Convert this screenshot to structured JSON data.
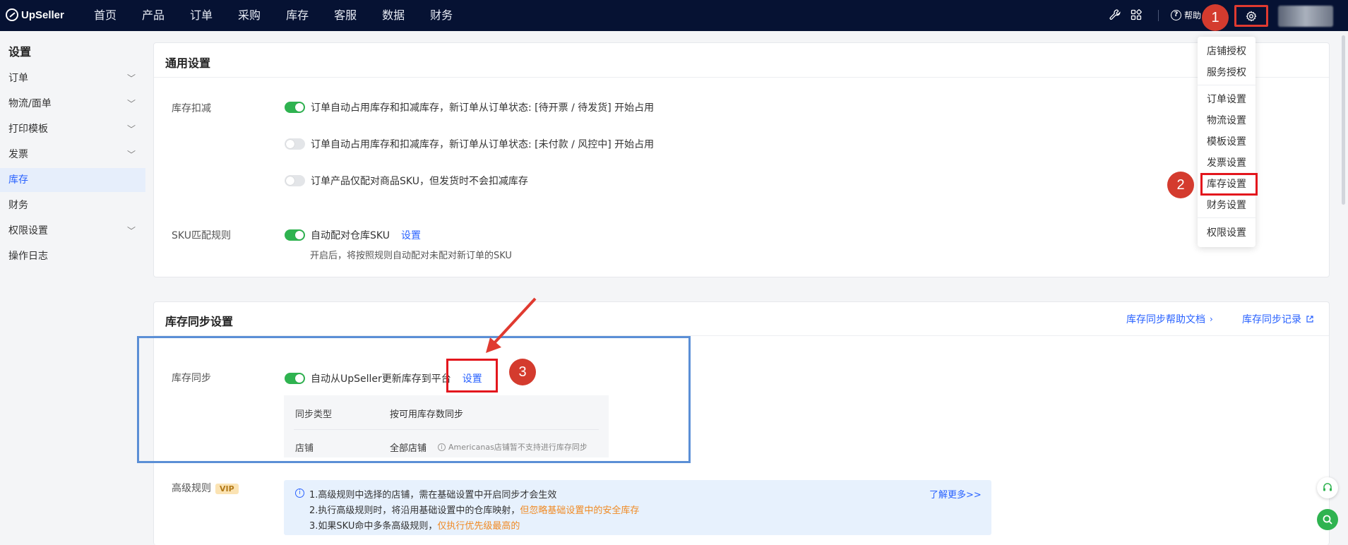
{
  "brand": "UpSeller",
  "nav": [
    "首页",
    "产品",
    "订单",
    "采购",
    "库存",
    "客服",
    "数据",
    "财务"
  ],
  "topbar": {
    "help_label": "帮助"
  },
  "sidebar": {
    "title": "设置",
    "items": [
      {
        "label": "订单",
        "expandable": true
      },
      {
        "label": "物流/面单",
        "expandable": true
      },
      {
        "label": "打印模板",
        "expandable": true
      },
      {
        "label": "发票",
        "expandable": true
      },
      {
        "label": "库存",
        "expandable": false,
        "active": true
      },
      {
        "label": "财务",
        "expandable": false
      },
      {
        "label": "权限设置",
        "expandable": true
      },
      {
        "label": "操作日志",
        "expandable": false
      }
    ]
  },
  "general": {
    "title": "通用设置",
    "stock_deduct_label": "库存扣减",
    "options": [
      {
        "text": "订单自动占用库存和扣减库存，新订单从订单状态: [待开票 / 待发货] 开始占用",
        "on": true
      },
      {
        "text": "订单自动占用库存和扣减库存，新订单从订单状态: [未付款 / 风控中] 开始占用",
        "on": false
      },
      {
        "text": "订单产品仅配对商品SKU，但发货时不会扣减库存",
        "on": false
      }
    ],
    "sku_rule_label": "SKU匹配规则",
    "sku_rule_text": "自动配对仓库SKU",
    "sku_rule_link": "设置",
    "sku_rule_note": "开启后，将按照规则自动配对未配对新订单的SKU"
  },
  "sync": {
    "title": "库存同步设置",
    "help_doc": "库存同步帮助文档",
    "record": "库存同步记录",
    "label": "库存同步",
    "toggle_text": "自动从UpSeller更新库存到平台",
    "settings_link": "设置",
    "type_label": "同步类型",
    "type_value": "按可用库存数同步",
    "store_label": "店铺",
    "store_value": "全部店铺",
    "store_note": "Americanas店铺暂不支持进行库存同步"
  },
  "advanced": {
    "label": "高级规则",
    "vip": "VIP",
    "line1": "1.高级规则中选择的店铺，需在基础设置中开启同步才会生效",
    "line2_a": "2.执行高级规则时，将沿用基础设置中的仓库映射，",
    "line2_b": "但忽略基础设置中的安全库存",
    "line3_a": "3.如果SKU命中多条高级规则，",
    "line3_b": "仅执行优先级最高的",
    "learn_more": "了解更多>>"
  },
  "dropdown": {
    "group1": [
      "店铺授权",
      "服务授权"
    ],
    "group2": [
      "订单设置",
      "物流设置",
      "模板设置",
      "发票设置",
      "库存设置",
      "财务设置"
    ],
    "group3": [
      "权限设置"
    ]
  },
  "badges": [
    "1",
    "2",
    "3"
  ],
  "colors": {
    "nav_bg": "#061233",
    "accent": "#2962ff",
    "toggle_on": "#2fb350",
    "annotation_red": "#d43b2e",
    "highlight_blue": "#5b8fd6"
  }
}
